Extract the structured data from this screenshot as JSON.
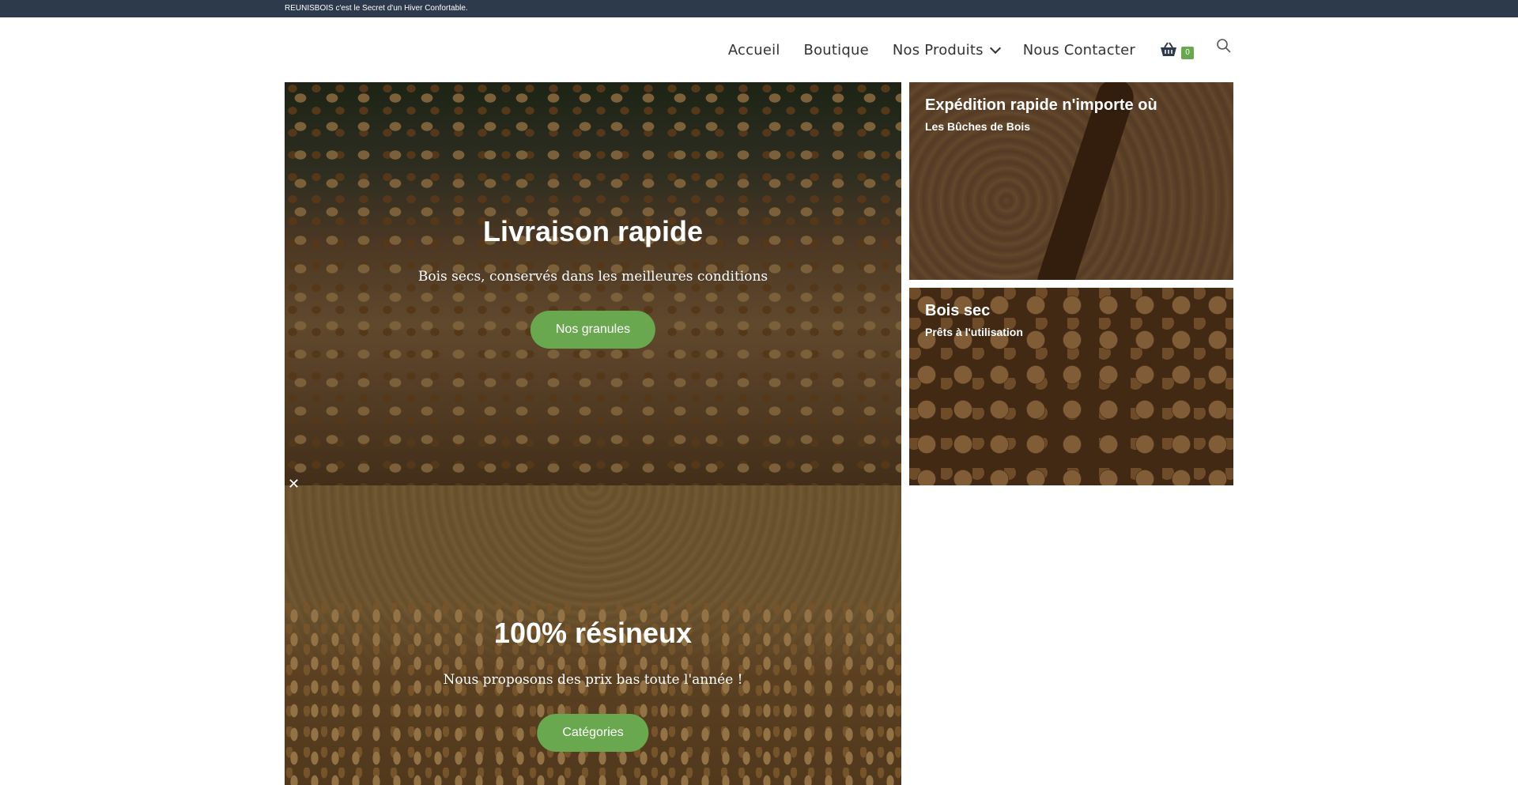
{
  "topbar": {
    "text": "REUNISBOIS c'est le Secret d'un Hiver Confortable."
  },
  "nav": {
    "items": [
      {
        "label": "Accueil"
      },
      {
        "label": "Boutique"
      },
      {
        "label": "Nos Produits"
      },
      {
        "label": "Nous Contacter"
      }
    ],
    "cart_count": "0"
  },
  "hero_main": {
    "title": "Livraison rapide",
    "subtitle": "Bois secs, conservés dans les meilleures conditions",
    "button": "Nos granules"
  },
  "hero_secondary": {
    "title": "100% résineux",
    "subtitle": "Nous proposons des prix bas toute l'année !",
    "button": "Catégories"
  },
  "side_top": {
    "title": "Expédition rapide n'importe où",
    "subtitle": "Les Bûches de Bois"
  },
  "side_middle": {
    "title": "Bois sec",
    "subtitle": "Prêts à l'utilisation"
  },
  "colors": {
    "accent": "#6aa84f",
    "topbar": "#2d3a4b"
  },
  "icons": [
    "basket-icon",
    "search-icon",
    "chevron-down-icon",
    "close-icon"
  ]
}
